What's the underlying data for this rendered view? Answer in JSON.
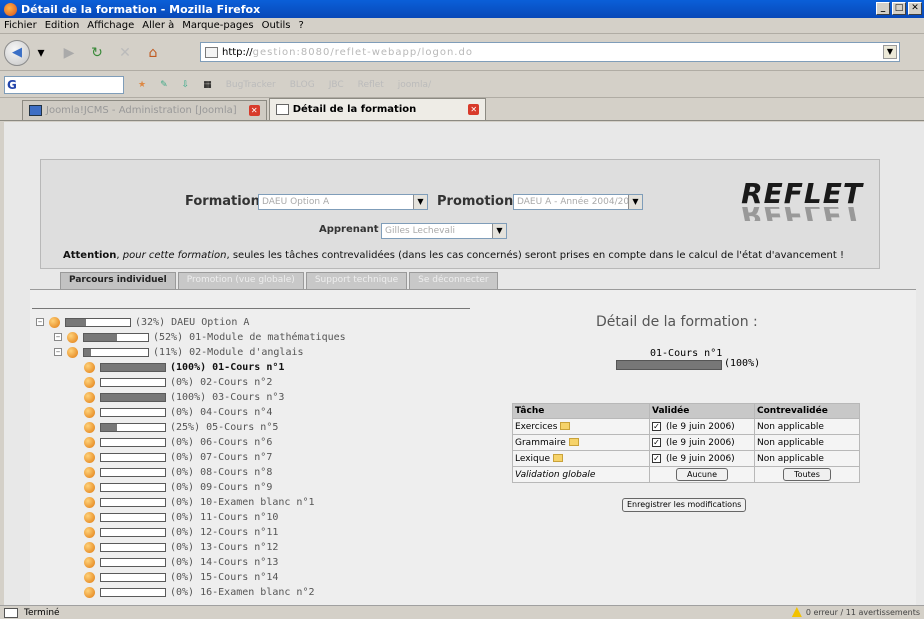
{
  "window": {
    "title": "Détail de la formation - Mozilla Firefox"
  },
  "menu": [
    "Fichier",
    "Edition",
    "Affichage",
    "Aller à",
    "Marque-pages",
    "Outils",
    "?"
  ],
  "url": {
    "prefix": "http://",
    "blurred": "gestion:8080/reflet-webapp/logon.do"
  },
  "bookmarks": {
    "search_label": "G",
    "items": [
      "BugTracker",
      "BLOG",
      "JBC",
      "Reflet",
      "joomla/"
    ]
  },
  "tabs": [
    {
      "label": "Joomla!JCMS - Administration [Joomla]",
      "active": false
    },
    {
      "label": "Détail de la formation",
      "active": true
    }
  ],
  "header": {
    "formation_label": "Formation :",
    "formation_value": "DAEU Option A",
    "promotion_label": "Promotion :",
    "promotion_value": "DAEU A - Année 2004/2005",
    "apprenant_label": "Apprenant :",
    "apprenant_value": "Gilles Lechevali",
    "logo": "REFLET",
    "attention_bold": "Attention",
    "attention_italic": "pour cette formation",
    "attention_rest": ", seules les tâches contrevalidées (dans les cas concernés) seront prises en compte dans le calcul de l'état d'avancement !"
  },
  "site_tabs": [
    "Parcours individuel",
    "Promotion (vue globale)",
    "Support technique",
    "Se déconnecter"
  ],
  "tree": [
    {
      "label": "(32%) DAEU Option A",
      "pct": 32,
      "level": 0,
      "bold": false
    },
    {
      "label": "(52%) 01-Module de mathématiques",
      "pct": 52,
      "level": 1,
      "bold": false
    },
    {
      "label": "(11%) 02-Module d'anglais",
      "pct": 11,
      "level": 1,
      "bold": false
    },
    {
      "label": "(100%) 01-Cours n°1",
      "pct": 100,
      "level": 2,
      "bold": true
    },
    {
      "label": "(0%) 02-Cours n°2",
      "pct": 0,
      "level": 2,
      "bold": false
    },
    {
      "label": "(100%) 03-Cours n°3",
      "pct": 100,
      "level": 2,
      "bold": false
    },
    {
      "label": "(0%) 04-Cours n°4",
      "pct": 0,
      "level": 2,
      "bold": false
    },
    {
      "label": "(25%) 05-Cours n°5",
      "pct": 25,
      "level": 2,
      "bold": false
    },
    {
      "label": "(0%) 06-Cours n°6",
      "pct": 0,
      "level": 2,
      "bold": false
    },
    {
      "label": "(0%) 07-Cours n°7",
      "pct": 0,
      "level": 2,
      "bold": false
    },
    {
      "label": "(0%) 08-Cours n°8",
      "pct": 0,
      "level": 2,
      "bold": false
    },
    {
      "label": "(0%) 09-Cours n°9",
      "pct": 0,
      "level": 2,
      "bold": false
    },
    {
      "label": "(0%) 10-Examen blanc n°1",
      "pct": 0,
      "level": 2,
      "bold": false
    },
    {
      "label": "(0%) 11-Cours n°10",
      "pct": 0,
      "level": 2,
      "bold": false
    },
    {
      "label": "(0%) 12-Cours n°11",
      "pct": 0,
      "level": 2,
      "bold": false
    },
    {
      "label": "(0%) 13-Cours n°12",
      "pct": 0,
      "level": 2,
      "bold": false
    },
    {
      "label": "(0%) 14-Cours n°13",
      "pct": 0,
      "level": 2,
      "bold": false
    },
    {
      "label": "(0%) 15-Cours n°14",
      "pct": 0,
      "level": 2,
      "bold": false
    },
    {
      "label": "(0%) 16-Examen blanc n°2",
      "pct": 0,
      "level": 2,
      "bold": false
    }
  ],
  "detail": {
    "title": "Détail de la formation :",
    "course": "01-Cours n°1",
    "pct_label": "(100%)",
    "pct": 100,
    "headers": [
      "Tâche",
      "Validée",
      "Contrevalidée"
    ],
    "rows": [
      {
        "task": "Exercices",
        "validated": "(le 9 juin 2006)",
        "counter": "Non applicable"
      },
      {
        "task": "Grammaire",
        "validated": "(le 9 juin 2006)",
        "counter": "Non applicable"
      },
      {
        "task": "Lexique",
        "validated": "(le 9 juin 2006)",
        "counter": "Non applicable"
      }
    ],
    "global_label": "Validation globale",
    "btn_none": "Aucune",
    "btn_all": "Toutes",
    "save_label": "Enregistrer les modifications"
  },
  "status": {
    "left": "Terminé",
    "right": "0 erreur / 11 avertissements"
  }
}
